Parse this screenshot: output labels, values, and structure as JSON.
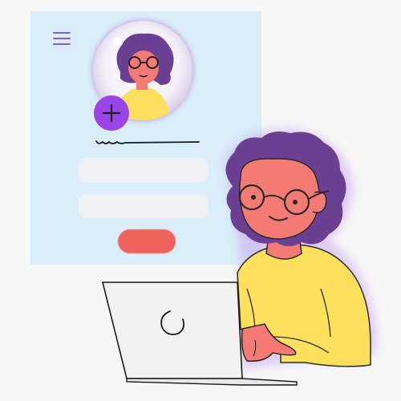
{
  "illustration": {
    "panel": {
      "background": "#d9eef8"
    },
    "menu_icon": "hamburger-menu-icon",
    "avatar_add_icon": "plus-icon",
    "accent_purple": "#9b45e8",
    "submit_color": "#f0625c",
    "person": {
      "hair": "#6b3f91",
      "skin": "#f37b74",
      "shirt": "#fde15c"
    },
    "laptop_icon": "power-icon"
  }
}
